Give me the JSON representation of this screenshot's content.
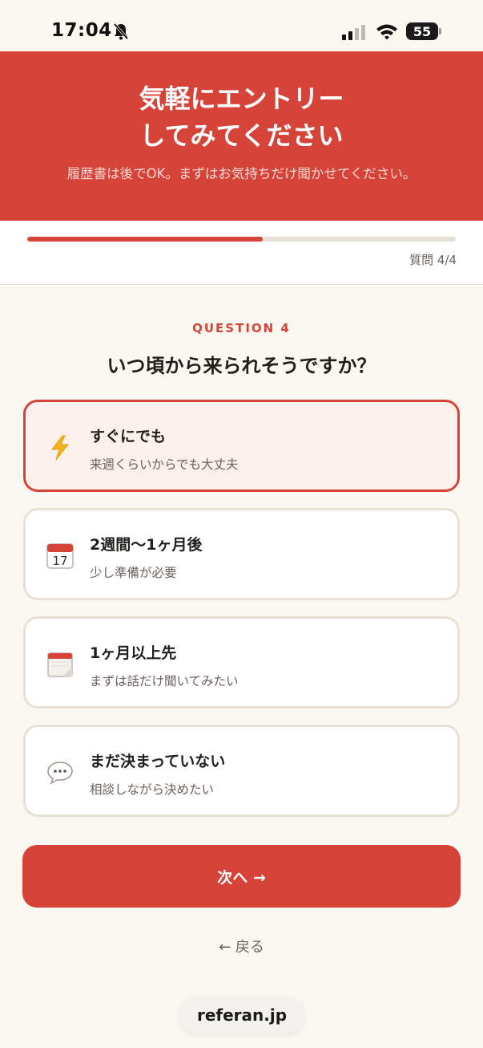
{
  "status_bar": {
    "time": "17:04",
    "battery": "55"
  },
  "header": {
    "title_line1": "気軽にエントリー",
    "title_line2": "してみてください",
    "subtitle": "履歴書は後でOK。まずはお気持ちだけ聞かせてください。"
  },
  "progress": {
    "fraction": 0.55,
    "label": "質問 4/4"
  },
  "question": {
    "number": "QUESTION 4",
    "text": "いつ頃から来られそうですか？"
  },
  "options": [
    {
      "icon": "lightning-icon",
      "title": "すぐにでも",
      "subtitle": "来週くらいからでも大丈夫",
      "selected": true
    },
    {
      "icon": "calendar-17-icon",
      "title": "2週間〜1ヶ月後",
      "subtitle": "少し準備が必要",
      "selected": false
    },
    {
      "icon": "tear-off-calendar-icon",
      "title": "1ヶ月以上先",
      "subtitle": "まずは話だけ聞いてみたい",
      "selected": false
    },
    {
      "icon": "speech-bubble-icon",
      "title": "まだ決まっていない",
      "subtitle": "相談しながら決めたい",
      "selected": false
    }
  ],
  "actions": {
    "next_label": "次へ →",
    "back_label": "← 戻る"
  },
  "browser": {
    "url": "referan.jp"
  },
  "colors": {
    "accent": "#d54339",
    "background": "#fbf8f1",
    "selected_background": "#fbf0ea"
  }
}
